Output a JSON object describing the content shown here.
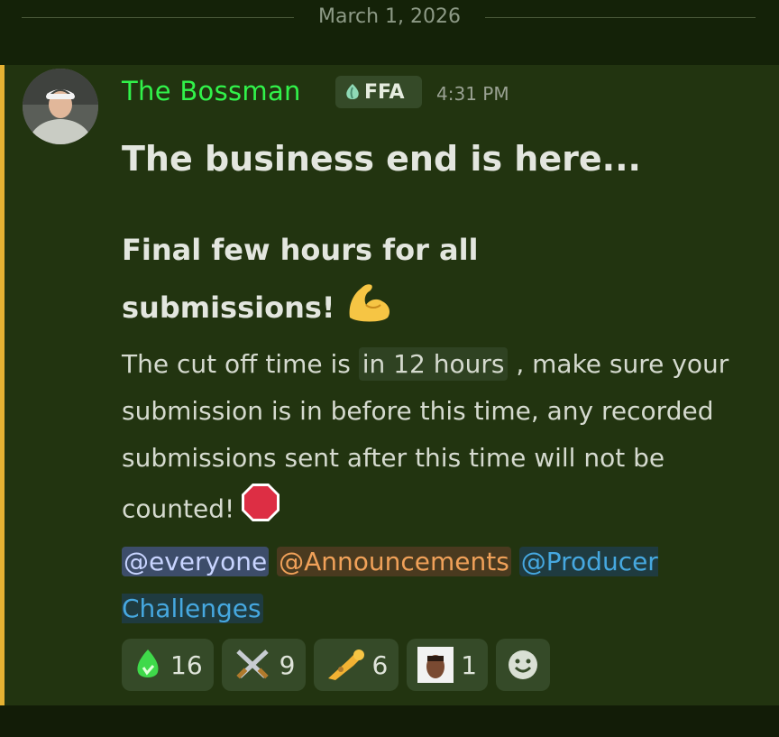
{
  "date_divider": "March 1, 2026",
  "message": {
    "author": "The Bossman",
    "role_tag": "FFA",
    "time": "4:31 PM",
    "heading": "The business end is here...",
    "subheading": "Final few hours for all submissions!",
    "body_pre": "The cut off time is ",
    "countdown": "in 12 hours",
    "body_post": " , make sure your submission is in before this time, any recorded submissions sent after this time will not be counted!",
    "mentions": [
      "@everyone",
      "@Announcements",
      "@Producer Challenges"
    ]
  },
  "reactions": [
    {
      "icon": "green-drop-icon",
      "count": "16"
    },
    {
      "icon": "crossed-swords-icon",
      "count": "9"
    },
    {
      "icon": "trumpet-icon",
      "count": "6"
    },
    {
      "icon": "face-avatar-icon",
      "count": "1"
    }
  ],
  "colors": {
    "accent_bar": "#e5b233",
    "username": "#31f24a",
    "background": "#223410"
  }
}
